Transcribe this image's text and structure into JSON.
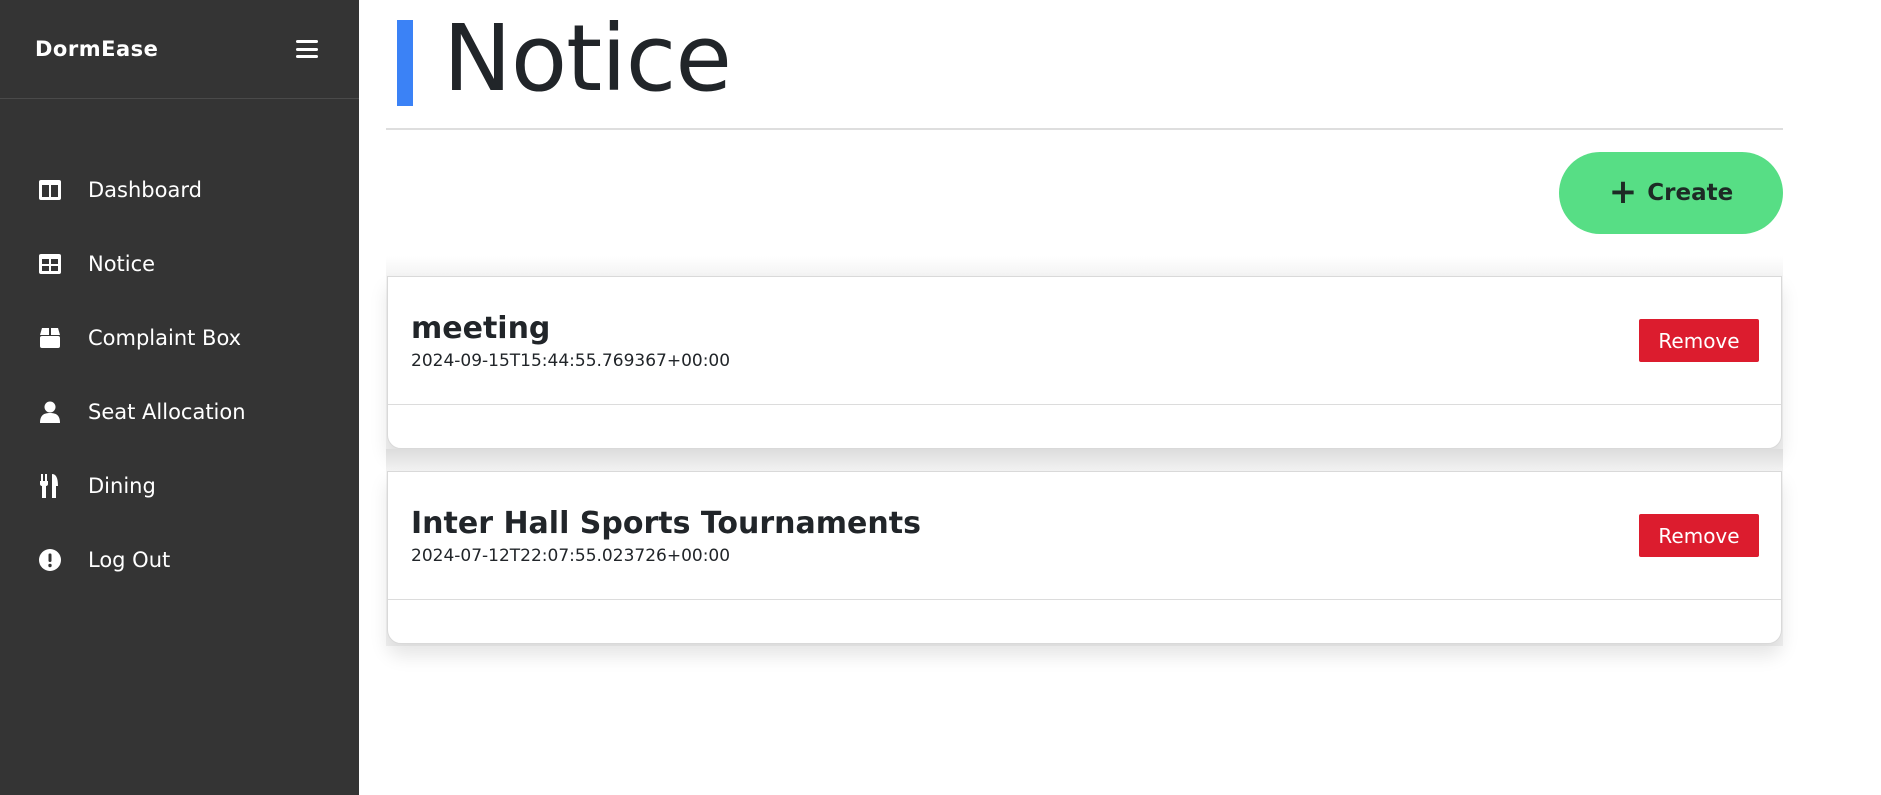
{
  "sidebar": {
    "brand": "DormEase",
    "menu_icon": "hamburger-icon",
    "items": [
      {
        "label": "Dashboard",
        "icon": "dashboard-icon"
      },
      {
        "label": "Notice",
        "icon": "table-icon"
      },
      {
        "label": "Complaint Box",
        "icon": "box-icon"
      },
      {
        "label": "Seat Allocation",
        "icon": "user-icon"
      },
      {
        "label": "Dining",
        "icon": "utensils-icon"
      },
      {
        "label": "Log Out",
        "icon": "exclamation-circle-icon"
      }
    ]
  },
  "header": {
    "title": "Notice",
    "accent_color": "#3b82f6"
  },
  "toolbar": {
    "create_label": "Create",
    "create_icon": "plus-icon",
    "create_color": "#57de85"
  },
  "notices": [
    {
      "title": "meeting",
      "date": "2024-09-15T15:44:55.769367+00:00",
      "remove_label": "Remove"
    },
    {
      "title": "Inter Hall Sports Tournaments",
      "date": "2024-07-12T22:07:55.023726+00:00",
      "remove_label": "Remove"
    }
  ],
  "colors": {
    "sidebar_bg": "#343434",
    "remove_button": "#dc1c2e"
  }
}
